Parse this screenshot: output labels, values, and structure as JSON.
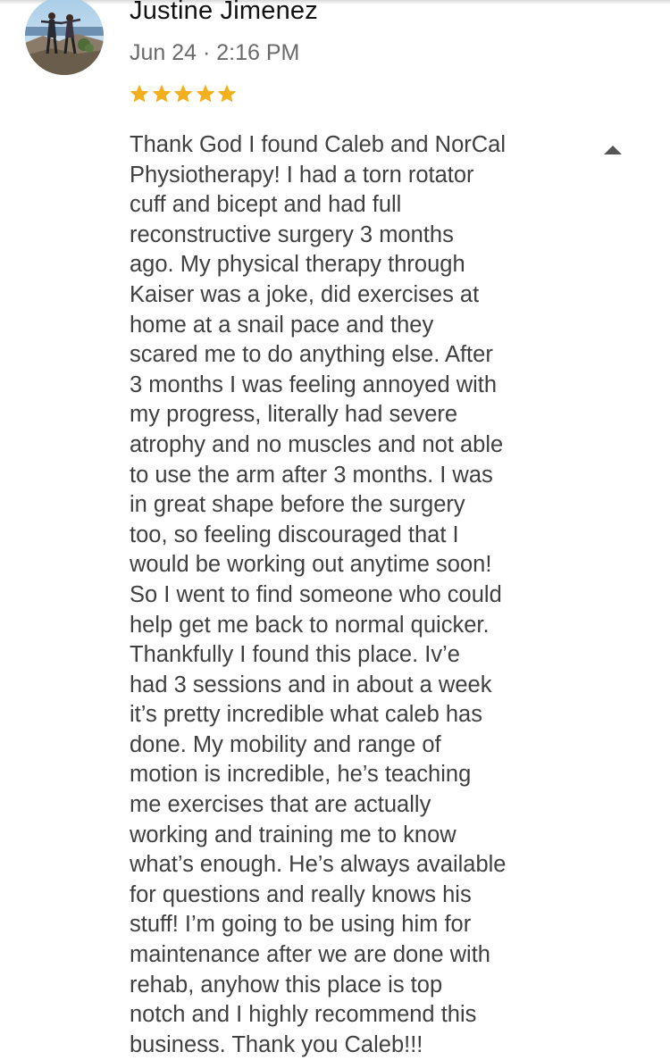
{
  "review": {
    "author_name": "Justine Jimenez",
    "date": "Jun 24 · 2:16 PM",
    "rating": 5,
    "rating_max": 5,
    "star_color": "#F2B01E",
    "collapse_icon": "triangle-up-icon",
    "text": "Thank God I found Caleb and NorCal\nPhysiotherapy! I had a torn rotator\ncuff and bicept and had full\nreconstructive surgery 3 months\nago. My physical therapy through\nKaiser was a joke, did exercises at\nhome at a snail pace and they\nscared me to do anything else. After\n3 months I was feeling annoyed with\nmy progress, literally had severe\natrophy and no muscles and not able\nto use the arm after 3 months. I was\nin great shape before the surgery\ntoo, so feeling discouraged that I\nwould be working out anytime soon!\nSo I went to find someone who could\nhelp get me back to normal quicker.\nThankfully I found this place. Iv’e\nhad 3 sessions and in about a week\nit’s pretty incredible what caleb has\ndone. My mobility and range of\nmotion is incredible, he’s teaching\nme exercises that are actually\nworking and training me to know\nwhat’s enough. He’s always available\nfor questions and really knows his\nstuff! I’m going to be using him for\nmaintenance after we are done with\nrehab, anyhow this place is top\nnotch and I highly recommend this\nbusiness. Thank you Caleb!!!"
  }
}
